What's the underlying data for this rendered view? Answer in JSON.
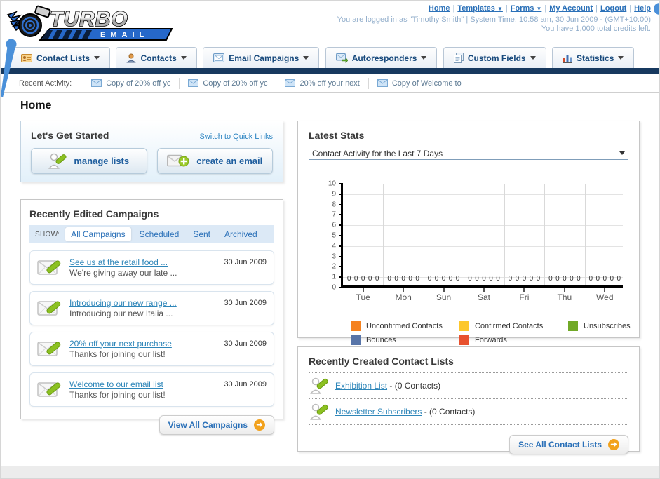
{
  "header": {
    "logo_title": "TURBO",
    "logo_subtitle": "EMAIL",
    "links": [
      {
        "label": "Home",
        "has_caret": false
      },
      {
        "label": "Templates",
        "has_caret": true
      },
      {
        "label": "Forms",
        "has_caret": true
      },
      {
        "label": "My Account",
        "has_caret": false
      },
      {
        "label": "Logout",
        "has_caret": false
      },
      {
        "label": "Help",
        "has_caret": false
      }
    ],
    "login_line": "You are logged in as \"Timothy Smith\" | System Time: 10:58 am, 30 Jun 2009 - (GMT+10:00)",
    "credits_line": "You have 1,000 total credits left."
  },
  "nav": {
    "tabs": [
      {
        "label": "Contact Lists",
        "icon": "contact-card-icon"
      },
      {
        "label": "Contacts",
        "icon": "person-icon"
      },
      {
        "label": "Email Campaigns",
        "icon": "envelope-icon"
      },
      {
        "label": "Autoresponders",
        "icon": "envelope-arrow-icon"
      },
      {
        "label": "Custom Fields",
        "icon": "pages-icon"
      },
      {
        "label": "Statistics",
        "icon": "bar-chart-icon"
      }
    ]
  },
  "recent_activity": {
    "label": "Recent Activity:",
    "items": [
      "Copy of 20% off yc",
      "Copy of 20% off yc",
      "20% off your next",
      "Copy of Welcome to"
    ]
  },
  "page_title": "Home",
  "get_started": {
    "title": "Let's Get Started",
    "switch_link": "Switch to Quick Links",
    "manage_lists_label": "manage lists",
    "create_email_label": "create an email"
  },
  "campaigns": {
    "title": "Recently Edited Campaigns",
    "show_label": "SHOW:",
    "tabs": [
      "All Campaigns",
      "Scheduled",
      "Sent",
      "Archived"
    ],
    "active_tab": "All Campaigns",
    "items": [
      {
        "title": "See us at the retail food ...",
        "subtitle": "We're giving away our late ...",
        "date": "30 Jun 2009"
      },
      {
        "title": "Introducing our new range ...",
        "subtitle": "Introducing our new Italia ...",
        "date": "30 Jun 2009"
      },
      {
        "title": "20% off your next purchase",
        "subtitle": "Thanks for joining our list!",
        "date": "30 Jun 2009"
      },
      {
        "title": "Welcome to our email list",
        "subtitle": "Thanks for joining our list!",
        "date": "30 Jun 2009"
      }
    ],
    "view_all_label": "View All Campaigns"
  },
  "stats": {
    "title": "Latest Stats",
    "dropdown_value": "Contact Activity for the Last 7 Days"
  },
  "chart_data": {
    "type": "bar",
    "title": "Contact Activity for the Last 7 Days",
    "categories": [
      "Tue",
      "Mon",
      "Sun",
      "Sat",
      "Fri",
      "Thu",
      "Wed"
    ],
    "series": [
      {
        "name": "Unconfirmed Contacts",
        "color": "#f5821f",
        "values": [
          0,
          0,
          0,
          0,
          0,
          0,
          0
        ]
      },
      {
        "name": "Confirmed Contacts",
        "color": "#fdc72c",
        "values": [
          0,
          0,
          0,
          0,
          0,
          0,
          0
        ]
      },
      {
        "name": "Unsubscribes",
        "color": "#71a927",
        "values": [
          0,
          0,
          0,
          0,
          0,
          0,
          0
        ]
      },
      {
        "name": "Bounces",
        "color": "#5774a8",
        "values": [
          0,
          0,
          0,
          0,
          0,
          0,
          0
        ]
      },
      {
        "name": "Forwards",
        "color": "#e8512e",
        "values": [
          0,
          0,
          0,
          0,
          0,
          0,
          0
        ]
      }
    ],
    "ylim": [
      0,
      10
    ],
    "yticks": [
      0,
      1,
      2,
      3,
      4,
      5,
      6,
      7,
      8,
      9,
      10
    ],
    "grid": true,
    "value_labels_shown": true,
    "legend_position": "bottom"
  },
  "contact_lists": {
    "title": "Recently Created Contact Lists",
    "items": [
      {
        "name": "Exhibition List",
        "suffix": "- (0 Contacts)"
      },
      {
        "name": "Newsletter Subscribers",
        "suffix": "- (0 Contacts)"
      }
    ],
    "see_all_label": "See All Contact Lists"
  },
  "colors": {
    "navy_bar": "#17395f",
    "link_blue": "#2a70b8",
    "status_text": "#92aecb",
    "button_text_blue": "#1f5e9e",
    "arrow_circle_orange": "#f2a21d",
    "logo_blue": "#2668c9"
  }
}
